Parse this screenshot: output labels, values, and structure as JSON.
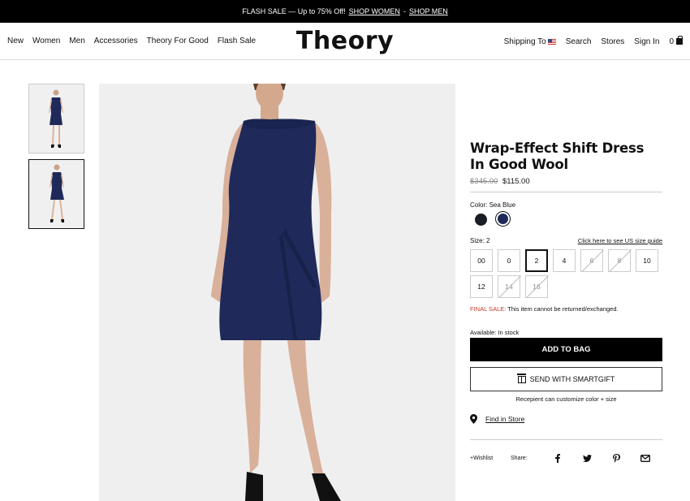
{
  "promo": {
    "text": "FLASH SALE — Up to 75% Off!",
    "link_women": "SHOP WOMEN",
    "separator": "-",
    "link_men": "SHOP MEN"
  },
  "header": {
    "logo": "Theory",
    "nav_left": [
      "New",
      "Women",
      "Men",
      "Accessories",
      "Theory For Good",
      "Flash Sale"
    ],
    "shipping_to": "Shipping To",
    "search": "Search",
    "stores": "Stores",
    "sign_in": "Sign In",
    "bag_count": "0"
  },
  "gallery": {
    "thumbnail_count": 2,
    "selected_index": 1
  },
  "product": {
    "title": "Wrap-Effect Shift Dress In Good Wool",
    "old_price": "$345.00",
    "price": "$115.00",
    "color_label": "Color: Sea Blue",
    "colors": [
      {
        "name": "black",
        "hex": "#1a1d24"
      },
      {
        "name": "sea blue",
        "hex": "#1f2a5a"
      }
    ],
    "size_label": "Size: 2",
    "size_guide": "Click here to see US size guide",
    "sizes": [
      {
        "label": "00",
        "available": true
      },
      {
        "label": "0",
        "available": true
      },
      {
        "label": "2",
        "available": true,
        "selected": true
      },
      {
        "label": "4",
        "available": true
      },
      {
        "label": "6",
        "available": false
      },
      {
        "label": "8",
        "available": false
      },
      {
        "label": "10",
        "available": true
      },
      {
        "label": "12",
        "available": true
      },
      {
        "label": "14",
        "available": false
      },
      {
        "label": "16",
        "available": false
      }
    ],
    "final_sale_label": "FINAL SALE:",
    "final_sale_text": " This item cannot be returned/exchanged.",
    "availability": "Available: In stock",
    "add_to_bag": "ADD TO BAG",
    "smartgift": "SEND WITH SMARTGIFT",
    "recipient_note": "Recepient can customize color + size",
    "find_in_store": "Find in Store",
    "wishlist": "+Wishlist",
    "share": "Share:",
    "share_icons": [
      "facebook-icon",
      "twitter-icon",
      "pinterest-icon",
      "email-icon"
    ]
  }
}
